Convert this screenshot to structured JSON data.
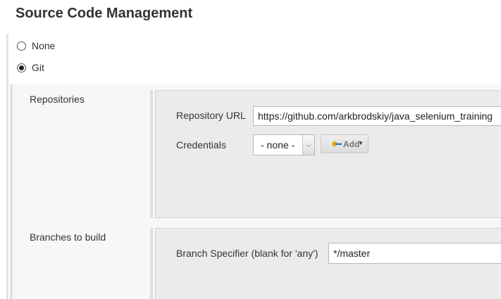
{
  "section": {
    "title": "Source Code Management"
  },
  "scm_options": [
    {
      "label": "None",
      "checked": false
    },
    {
      "label": "Git",
      "checked": true
    }
  ],
  "repositories": {
    "label": "Repositories",
    "url_label": "Repository URL",
    "url_value": "https://github.com/arkbrodskiy/java_selenium_training",
    "credentials_label": "Credentials",
    "credentials_value": "- none -",
    "add_label": "Add"
  },
  "branches": {
    "label": "Branches to build",
    "specifier_label": "Branch Specifier (blank for 'any')",
    "specifier_value": "*/master"
  },
  "colors": {
    "key_icon": "#d9a400",
    "key_icon_blue": "#3b7bc8"
  }
}
